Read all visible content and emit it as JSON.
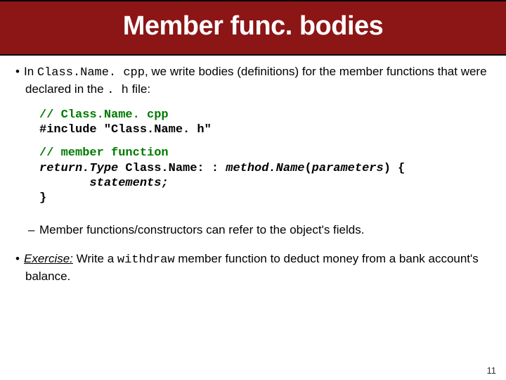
{
  "title": "Member func. bodies",
  "bullet": {
    "pre": "In ",
    "file1": "Class.Name. cpp",
    "mid": ", we write bodies (definitions) for the member functions that were declared in the ",
    "file2": ". h",
    "post": " file:"
  },
  "code1": {
    "l1": "// Class.Name. cpp",
    "l2": "#include \"Class.Name. h\""
  },
  "code2": {
    "l1": "// member function",
    "l2a": "return.Type",
    "l2b": " Class.Name: : ",
    "l2c": "method.Name",
    "l2d": "(",
    "l2e": "parameters",
    "l2f": ") {",
    "l3a": "       ",
    "l3b": "statements;",
    "l4": "}"
  },
  "sub": "Member functions/constructors can refer to the object's fields.",
  "exercise": {
    "label": "Exercise:",
    "pre": " Write a ",
    "fn": "withdraw",
    "post": " member function to deduct money from a bank account's balance."
  },
  "page": "11"
}
